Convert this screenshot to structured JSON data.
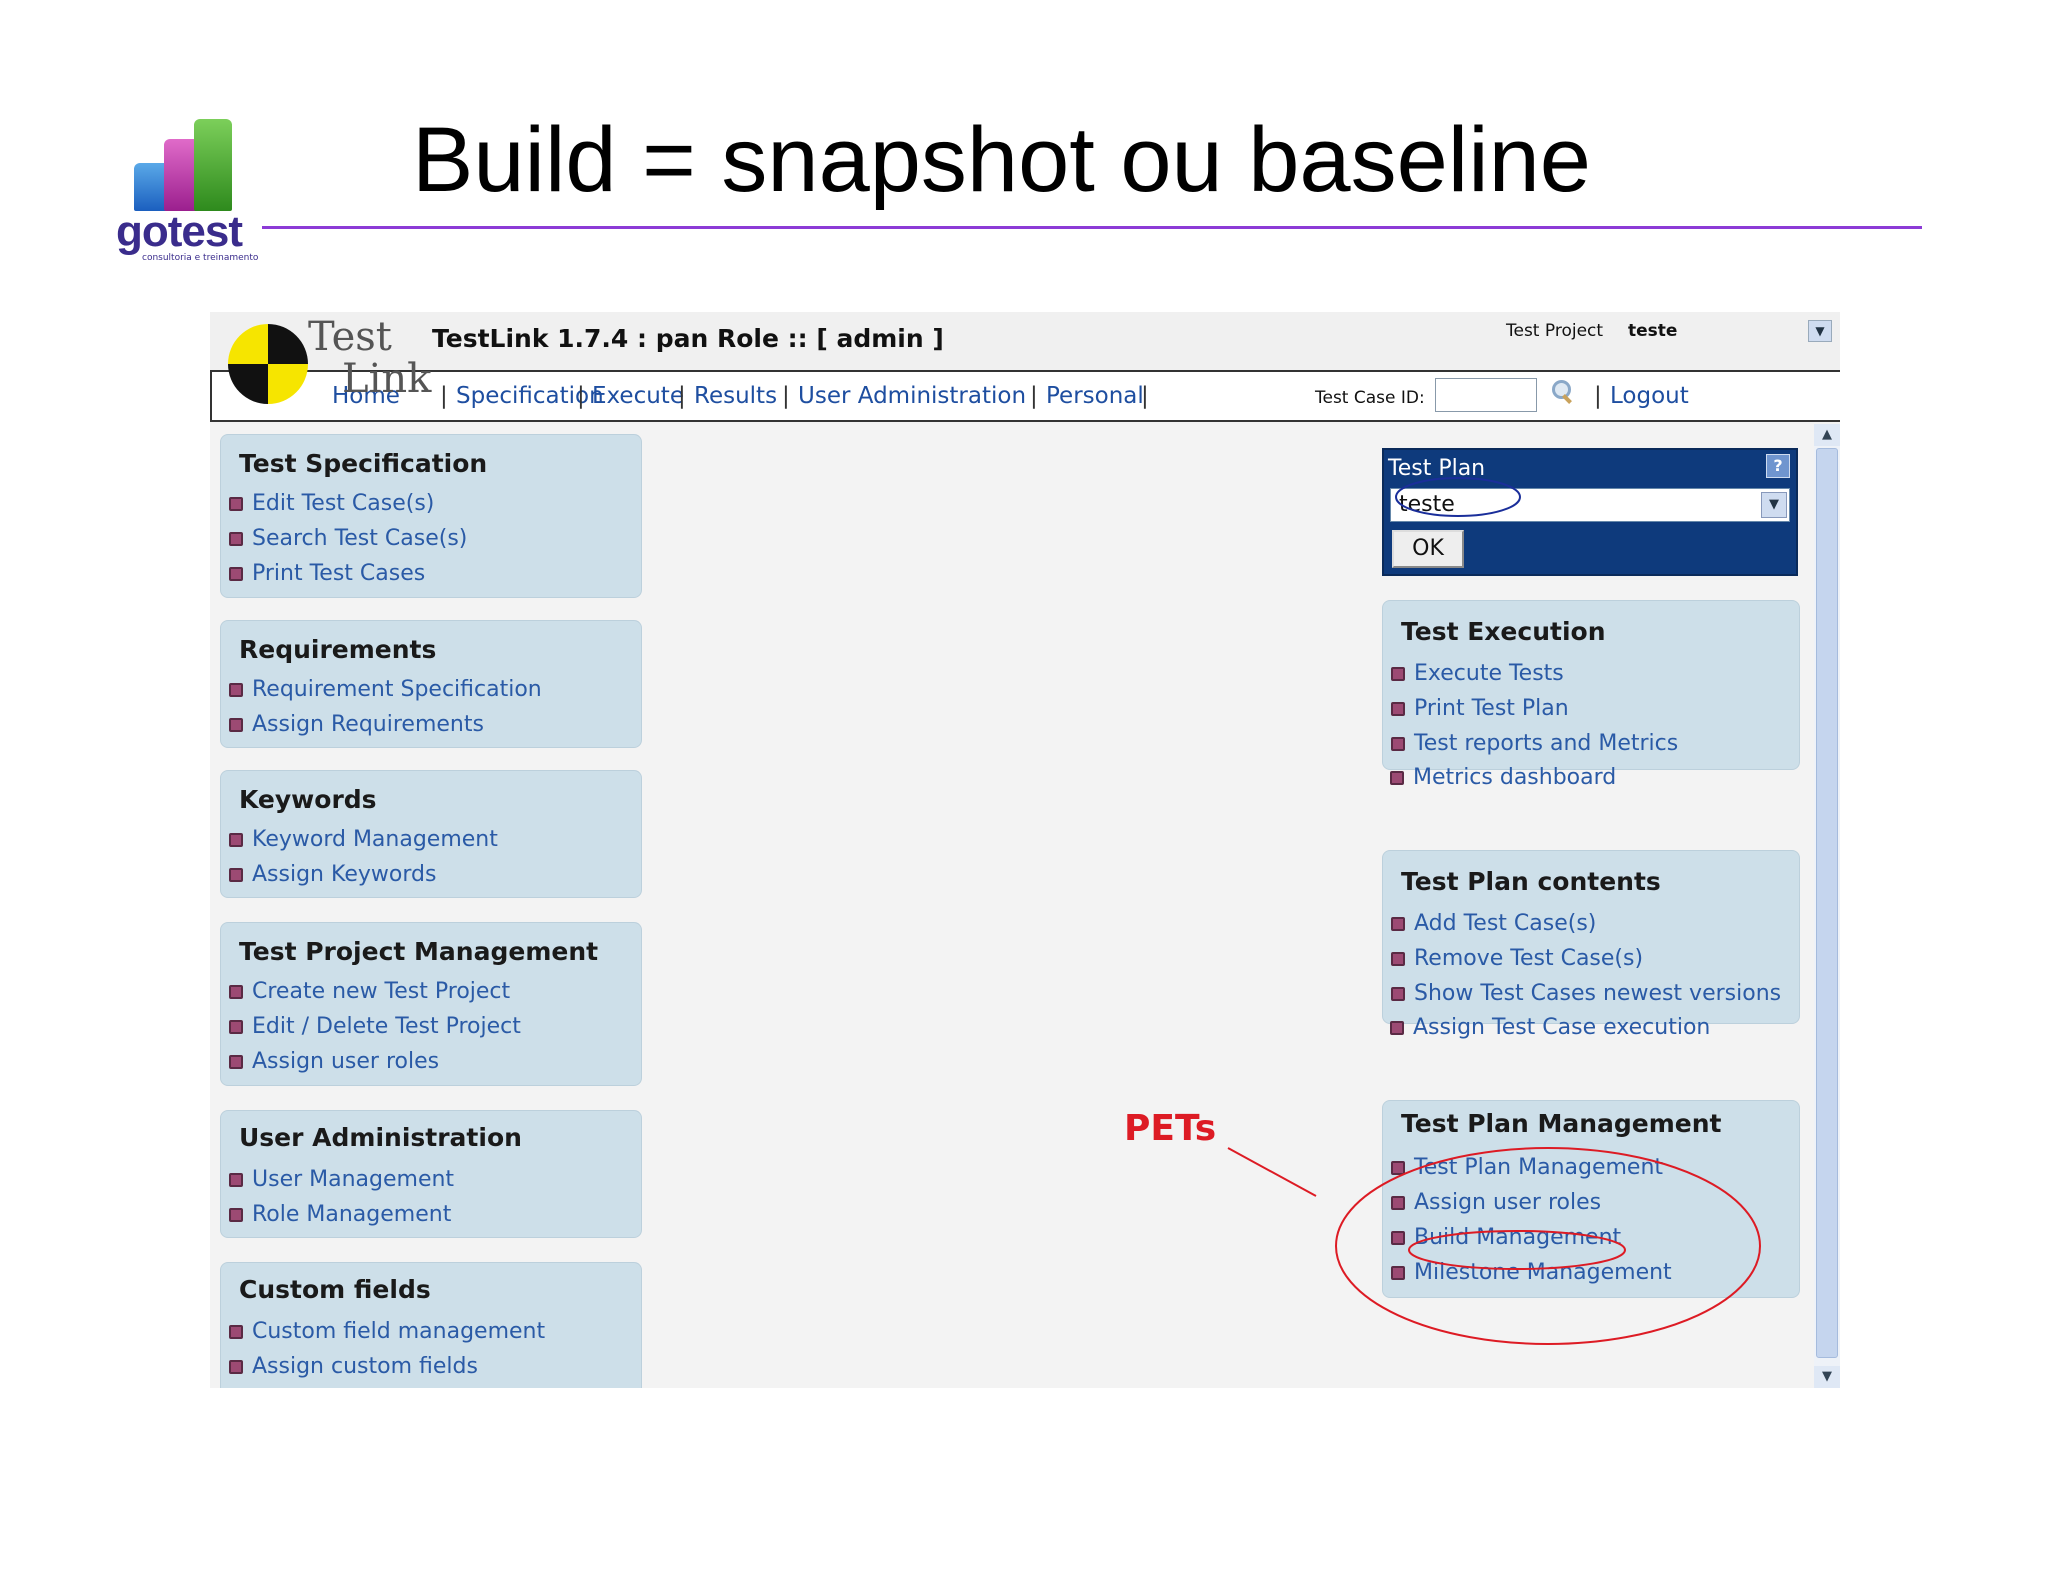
{
  "slide": {
    "title": "Build = snapshot ou baseline",
    "logo_word": "gotest",
    "logo_sub": "consultoria e treinamento",
    "annotation_label": "PETs"
  },
  "colors": {
    "title_rule": "#8c3bd6",
    "menu_box": "#cddfe9",
    "link": "#2a5aa6",
    "test_plan_box": "#0e3a7c",
    "annotation": "#dd1b24"
  },
  "header": {
    "logo_top": "Test",
    "logo_bottom": "Link",
    "version_text": "TestLink 1.7.4 : pan Role :: [ admin ]",
    "project_label": "Test Project",
    "project_name": "teste",
    "project_dropdown_icon": "chevron-down-icon"
  },
  "nav": {
    "items": [
      "Home",
      "Specification",
      "Execute",
      "Results",
      "User Administration",
      "Personal"
    ],
    "separator": "|",
    "tcid_label": "Test Case ID:",
    "tcid_value": "",
    "search_icon": "search-icon",
    "logout": "Logout"
  },
  "left_menus": [
    {
      "title": "Test Specification",
      "items": [
        "Edit Test Case(s)",
        "Search Test Case(s)",
        "Print Test Cases"
      ]
    },
    {
      "title": "Requirements",
      "items": [
        "Requirement Specification",
        "Assign Requirements"
      ]
    },
    {
      "title": "Keywords",
      "items": [
        "Keyword Management",
        "Assign Keywords"
      ]
    },
    {
      "title": "Test Project Management",
      "items": [
        "Create new Test Project",
        "Edit / Delete Test Project",
        "Assign user roles"
      ]
    },
    {
      "title": "User Administration",
      "items": [
        "User Management",
        "Role Management"
      ]
    },
    {
      "title": "Custom fields",
      "items": [
        "Custom field management",
        "Assign custom fields"
      ]
    }
  ],
  "test_plan": {
    "title": "Test Plan",
    "help": "?",
    "selected": "teste",
    "ok": "OK"
  },
  "right_menus": [
    {
      "title": "Test Execution",
      "items": [
        "Execute Tests",
        "Print Test Plan",
        "Test reports and Metrics",
        "Metrics dashboard"
      ]
    },
    {
      "title": "Test Plan contents",
      "items": [
        "Add Test Case(s)",
        "Remove Test Case(s)",
        "Show Test Cases newest versions",
        "Assign Test Case execution"
      ]
    },
    {
      "title": "Test Plan Management",
      "items": [
        "Test Plan Management",
        "Assign user roles",
        "Build Management",
        "Milestone Management"
      ]
    }
  ]
}
